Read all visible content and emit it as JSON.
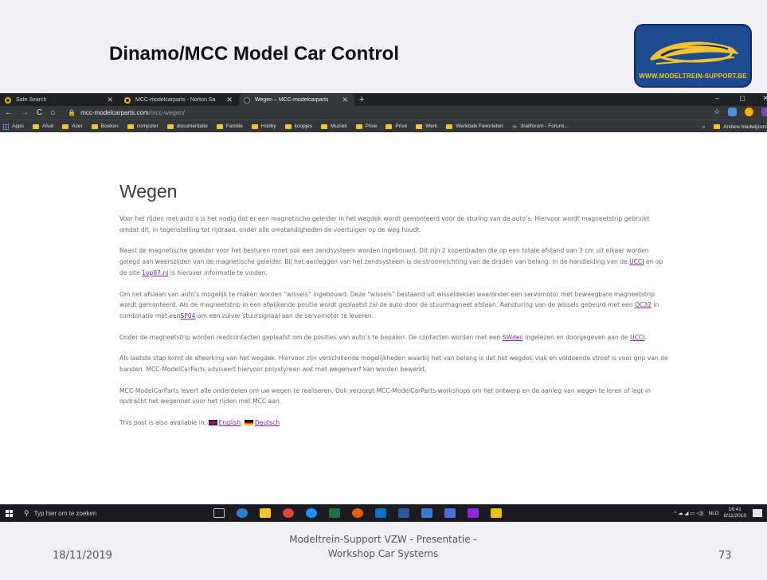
{
  "slide": {
    "title": "Dinamo/MCC Model Car Control",
    "logo_text": "WWW.MODELTREIN-SUPPORT.BE",
    "footer_date": "18/11/2019",
    "footer_line1": "Modeltrein-Support  VZW - Presentatie -",
    "footer_line2": "Workshop  Car Systems",
    "page_number": "73"
  },
  "browser": {
    "tabs": [
      {
        "label": "Safe Search",
        "active": false,
        "icon_color": "#f4b400"
      },
      {
        "label": "MCC-modelcarparts - Norton Sa",
        "active": false,
        "icon_color": "#f4b400"
      },
      {
        "label": "Wegen – MCC-modelcarparts",
        "active": true,
        "icon_color": "#222222"
      }
    ],
    "new_tab_label": "+",
    "window_controls": {
      "minimize": "–",
      "maximize": "◻",
      "close": "✕"
    },
    "nav": {
      "back": "←",
      "forward": "→",
      "reload": "C",
      "home": "⌂"
    },
    "address": {
      "domain": "mcc-modelcarparts.com",
      "path": "/mcc-wegen/"
    },
    "bookmarks": [
      "Apps",
      "Afval",
      "Acer",
      "Boeken",
      "computer",
      "documentatie",
      "Familie",
      "Hobby",
      "koopjes",
      "Muziek",
      "Prive",
      "Privé",
      "Werk",
      "Werkbalk Favorieten",
      "3railforum - Forumi..."
    ],
    "bookmarks_more": "»",
    "other_bookmarks": "Andere bladwijzers"
  },
  "page": {
    "heading": "Wegen",
    "p1": "Voor het rijden met auto’s is het nodig dat er een magnetische geleider in het wegdek wordt gemonteerd voor de sturing van de auto’s. Hiervoor wordt magneetstrip gebruikt omdat dit, in tegenstelling tot rijdraad, onder alle omstandigheden de voertuigen op de weg houdt.",
    "p2_a": "Naast de magnetische geleider voor het besturen moet ook een zendsysteem worden ingebouwd. Dit zijn 2 koperdraden die  op een totale afstand van 3 cm uit elkaar worden gelegd aan weerszijden van de magnetische geleider. Bij het aanleggen van het zendsysteem is de stroomrichting van de draden van belang. In de handleiding van de ",
    "p2_link1": "UCCI",
    "p2_b": " en op de site ",
    "p2_link2": "1op87.nl",
    "p2_c": " is hierover informatie te vinden.",
    "p3_a": "Om het afslaan van auto’s mogelijk te maken worden “wissels” ingebouwd. Deze “wissels” bestaand uit wisseldeksel waaronder een servomotor met beweegbare magneetstrip wordt gemonteerd. Als de magneetstrip in een afwijkende positie wordt geplaatst zal de auto door de stuurmagneet afslaan. Aansturing van de wissels gebeurd met een ",
    "p3_link1": "OC32",
    "p3_b": " in combinatie met een",
    "p3_link2": "SP04",
    "p3_c": " om een zuiver stuursignaal aan de servomotor te leveren.",
    "p4_a": "Onder de magneetstrip worden reedcontacten geplaatst om de posities van auto’s te bepalen. De contacten worden met een ",
    "p4_link1": "SWdec",
    "p4_b": " ingelezen en doorgegeven aan de ",
    "p4_link2": "UCCI",
    "p4_c": ".",
    "p5": "Als laatste stap komt de afwerking van het wegdek. Hiervoor zijn verschillende mogelijkheden waarbij het van belang is dat het wegdek vlak en voldoende stroef is voor grip van de banden. MCC-ModelCarParts adviseert hiervoor polystyreen wat met wegenverf kan worden bewerkt.",
    "p6": "MCC-ModelCarParts levert alle onderdelen om uw wegen te realiseren. Ook verzorgt MCC-ModelCarParts workshops om het ontwerp en de aanleg van wegen te leren of legt in opdracht het wegennet voor het rijden met MCC aan.",
    "p7_a": "This post is also available in: ",
    "p7_link1": "English",
    "p7_b": ", ",
    "p7_link2": "Deutsch"
  },
  "taskbar": {
    "search_placeholder": "Typ hier om te zoeken",
    "language": "NLD",
    "time": "16:41",
    "date": "8/11/2019",
    "tray_icons": "^ ☁ ◢ ▭ ◁))"
  },
  "colors": {
    "link": "#7b2aa8",
    "logo_bg": "#1d4b8f",
    "logo_accent": "#f4c430"
  }
}
